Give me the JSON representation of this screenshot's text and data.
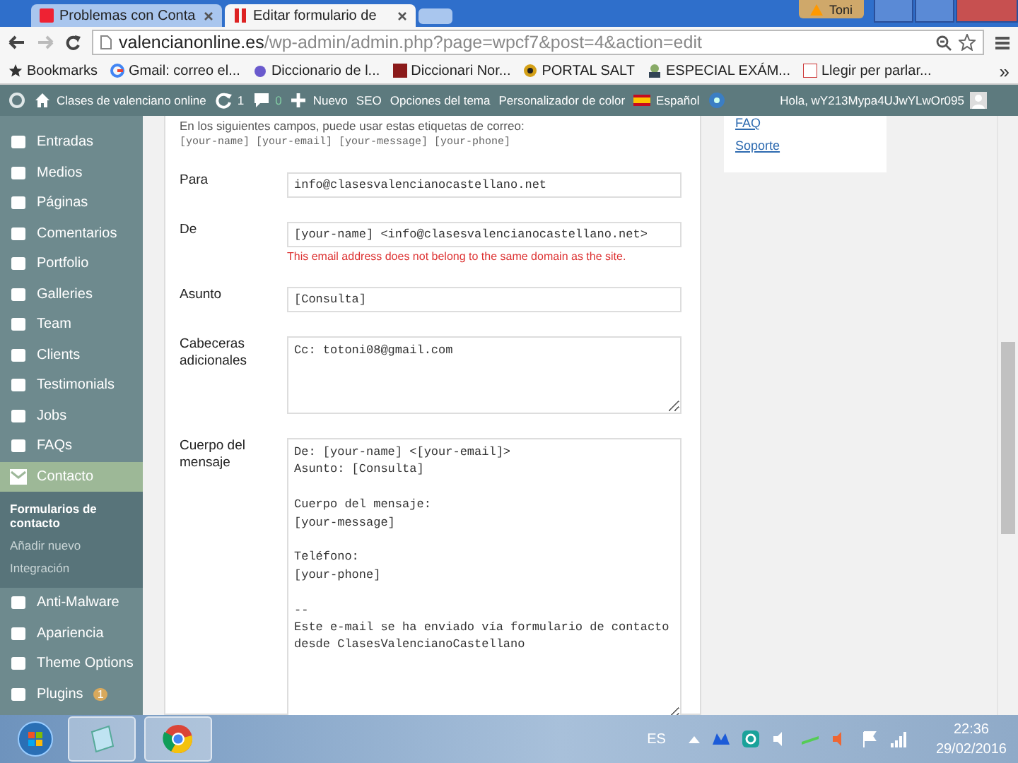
{
  "browser": {
    "tabs": [
      {
        "title": "Problemas con Conta",
        "selected": false
      },
      {
        "title": "Editar formulario de",
        "selected": true
      }
    ],
    "user": "Toni",
    "address": {
      "domain": "valencianonline.es",
      "path": "/wp-admin/admin.php?page=wpcf7&post=4&action=edit"
    },
    "bookmarks": [
      "Bookmarks",
      "Gmail: correo el...",
      "Diccionario de l...",
      "Diccionari Nor...",
      "PORTAL SALT",
      "ESPECIAL EXÁM...",
      "Llegir per parlar..."
    ],
    "bookmarks_more": "»"
  },
  "admin_bar": {
    "site": "Clases de valenciano online",
    "updates": "1",
    "comments": "0",
    "new": "Nuevo",
    "menu": [
      "SEO",
      "Opciones del tema",
      "Personalizador de color"
    ],
    "language": "Español",
    "greeting": "Hola, wY213Mypa4UJwYLwOr095"
  },
  "sidebar": {
    "items": [
      {
        "label": "Entradas",
        "selected": false
      },
      {
        "label": "Medios",
        "selected": false
      },
      {
        "label": "Páginas",
        "selected": false
      },
      {
        "label": "Comentarios",
        "selected": false
      },
      {
        "label": "Portfolio",
        "selected": false
      },
      {
        "label": "Galleries",
        "selected": false
      },
      {
        "label": "Team",
        "selected": false
      },
      {
        "label": "Clients",
        "selected": false
      },
      {
        "label": "Testimonials",
        "selected": false
      },
      {
        "label": "Jobs",
        "selected": false
      },
      {
        "label": "FAQs",
        "selected": false
      },
      {
        "label": "Contacto",
        "selected": true,
        "children": [
          {
            "label": "Formularios de contacto",
            "selected": true
          },
          {
            "label": "Añadir nuevo",
            "selected": false
          },
          {
            "label": "Integración",
            "selected": false
          }
        ]
      },
      {
        "label": "Anti-Malware",
        "selected": false
      },
      {
        "label": "Apariencia",
        "selected": false
      },
      {
        "label": "Theme Options",
        "selected": false
      },
      {
        "label": "Plugins",
        "selected": false,
        "badge": "1"
      }
    ]
  },
  "form": {
    "hint": "En los siguientes campos, puede usar estas etiquetas de correo:",
    "tags": "[your-name] [your-email] [your-message] [your-phone]",
    "fields": [
      {
        "label": "Para",
        "kind": "input",
        "value": "info@clasesvalencianocastellano.net"
      },
      {
        "label": "De",
        "kind": "input",
        "value": "[your-name] <info@clasesvalencianocastellano.net>",
        "error": "This email address does not belong to the same domain as the site."
      },
      {
        "label": "Asunto",
        "kind": "input",
        "value": "[Consulta]"
      },
      {
        "label": "Cabeceras adicionales",
        "kind": "textarea",
        "value": "Cc: totoni08@gmail.com"
      },
      {
        "label": "Cuerpo del mensaje",
        "kind": "body",
        "value": "De: [your-name] <[your-email]>\nAsunto: [Consulta]\n\nCuerpo del mensaje:\n[your-message]\n\nTeléfono:\n[your-phone]\n\n--\nEste e-mail se ha enviado vía formulario de contacto\ndesde ClasesValencianoCastellano"
      }
    ]
  },
  "side_links": [
    "FAQ",
    "Soporte"
  ],
  "taskbar": {
    "language": "ES",
    "time": "22:36",
    "date": "29/02/2016"
  }
}
